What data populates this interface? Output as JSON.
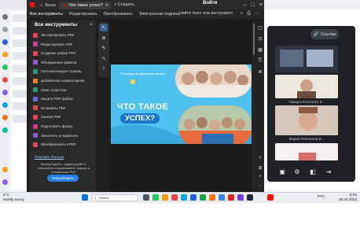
{
  "colors": {
    "accent": "#2680eb",
    "slide_bg": "#4fc1ee",
    "dark_window": "#1f1f1f",
    "meet_panel": "#202124"
  },
  "window": {
    "tabs": [
      {
        "label": "Веню",
        "icon": "home-icon"
      },
      {
        "label": "Что такое успех?",
        "icon": "pdf-icon"
      }
    ],
    "create_label": "+ Создать",
    "sign_in_label": "Войти"
  },
  "menubar": {
    "items": [
      "Все инструменты",
      "Редактировать",
      "Преобразовать",
      "Электронная подпись"
    ],
    "search_label": "Найти текст или инструмент"
  },
  "tools_panel": {
    "title": "Все инструменты",
    "items": [
      {
        "label": "Экспортировать PDF",
        "color": "#e34850"
      },
      {
        "label": "Редактировать PDF",
        "color": "#d83790"
      },
      {
        "label": "Создание файла PDF",
        "color": "#e34850"
      },
      {
        "label": "Объединение файлов",
        "color": "#9256d9"
      },
      {
        "label": "Систематизация страниц",
        "color": "#2d9d78"
      },
      {
        "label": "Добавление комментариев",
        "color": "#e68619"
      },
      {
        "label": "Скан. и распозн.",
        "color": "#2d9d78"
      },
      {
        "label": "Защита PDF-файла",
        "color": "#6767ec"
      },
      {
        "label": "Исправить PDF",
        "color": "#e34850"
      },
      {
        "label": "Сжатие PDF",
        "color": "#e34850"
      },
      {
        "label": "Подготовить форму",
        "color": "#d83790"
      },
      {
        "label": "Заполнить и подписать",
        "color": "#9256d9"
      },
      {
        "label": "Преобразовать в PDF",
        "color": "#e34850"
      }
    ],
    "show_less": "Показать больше",
    "promo_text": "Конвертируйте, редактируйте и электронно подписывайте формы и соглашения PDF",
    "try_button": "Попробовать"
  },
  "slide": {
    "logo_text": "Я горжусь  ★ Движение первых",
    "title_line1": "ЧТО ТАКОЕ",
    "title_line2": "УСПЕХ?"
  },
  "meeting": {
    "link_button": "Ссылка",
    "participants": [
      {
        "name": ""
      },
      {
        "name": "Тамара Игнатенко 5..."
      },
      {
        "name": "Мария Рейзенков В..."
      },
      {
        "name": ""
      }
    ]
  },
  "taskbar": {
    "weather_temp": "2°C",
    "weather_desc": "Mostly sunny",
    "search_placeholder": "Поиск",
    "language": "РУС",
    "time": "8:03",
    "date": "26.04.2023"
  }
}
